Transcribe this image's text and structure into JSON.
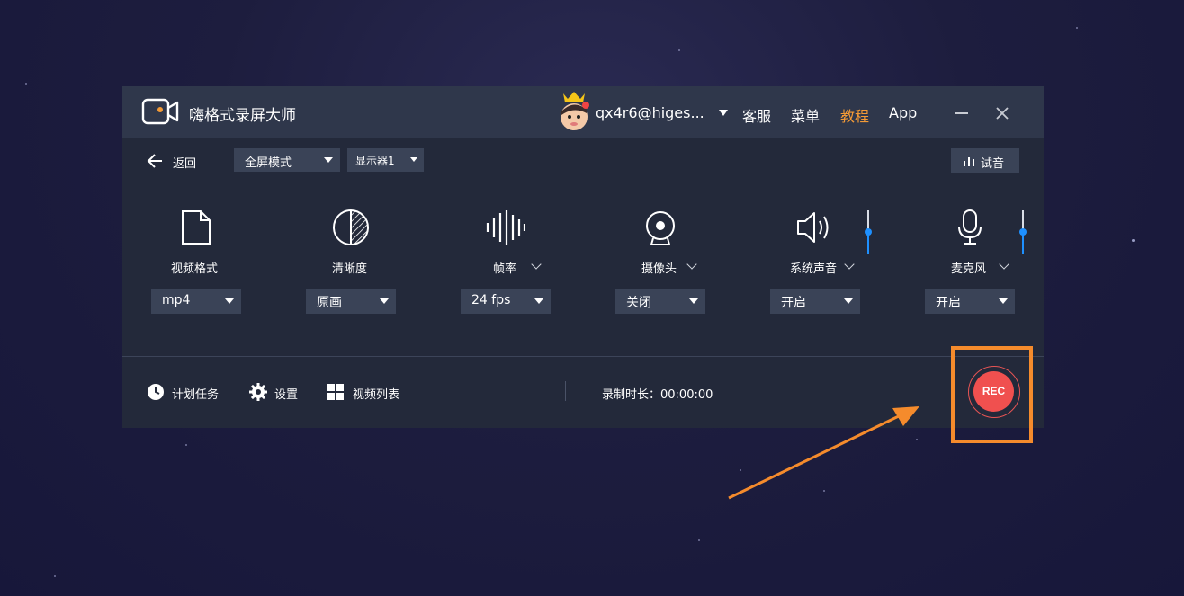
{
  "window": {
    "app_title": "嗨格式录屏大师",
    "user": "qx4r6@higes...",
    "nav": [
      "客服",
      "菜单",
      "教程",
      "App"
    ]
  },
  "toolbar": {
    "back_label": "返回",
    "mode_select": "全屏模式",
    "display_select": "显示器1",
    "audition_label": "试音"
  },
  "settings": [
    {
      "label": "视频格式",
      "value": "mp4",
      "icon": "file-icon"
    },
    {
      "label": "清晰度",
      "value": "原画",
      "icon": "half-circle-icon"
    },
    {
      "label": "帧率",
      "value": "24 fps",
      "icon": "waveform-icon"
    },
    {
      "label": "摄像头",
      "value": "关闭",
      "icon": "webcam-icon"
    },
    {
      "label": "系统声音",
      "value": "开启",
      "icon": "speaker-icon",
      "volume_level": 0.5
    },
    {
      "label": "麦克风",
      "value": "开启",
      "icon": "microphone-icon",
      "volume_level": 0.5
    }
  ],
  "bottom": {
    "schedule_label": "计划任务",
    "settings_label": "设置",
    "video_list_label": "视频列表",
    "duration_text": "录制时长：00:00:00",
    "rec_label": "REC"
  },
  "colors": {
    "accent_orange": "#f58b2c",
    "rec_red": "#f0504f",
    "slider_blue": "#1e90ff",
    "panel_bg": "#23293a",
    "titlebar_bg": "#2f374b"
  }
}
